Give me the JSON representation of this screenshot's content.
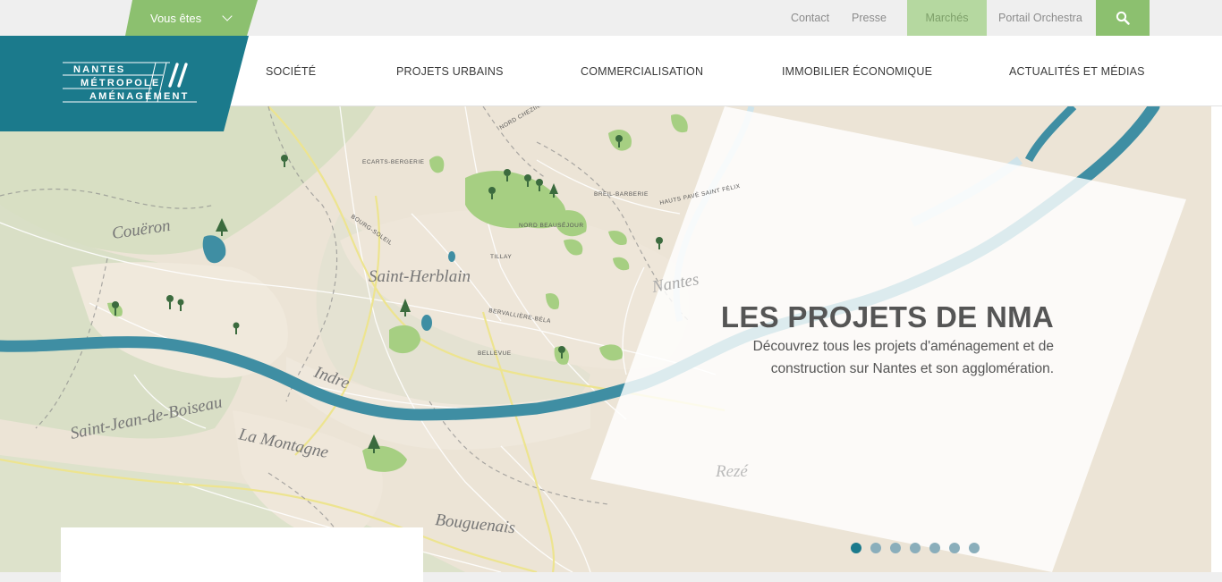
{
  "topbar": {
    "audience_label": "Vous êtes",
    "links": [
      "Contact",
      "Presse",
      "Marchés",
      "Portail Orchestra"
    ],
    "search_icon": "search-icon"
  },
  "logo": {
    "line1": "NANTES",
    "line2": "MÉTROPOLE",
    "line3": "AMÉNAGEMENT"
  },
  "nav": [
    "SOCIÉTÉ",
    "PROJETS URBAINS",
    "COMMERCIALISATION",
    "IMMOBILIER ÉCONOMIQUE",
    "ACTUALITÉS ET MÉDIAS"
  ],
  "hero": {
    "title": "LES PROJETS DE NMA",
    "description": "Découvrez tous les projets d'aménagement et de construction sur Nantes et son agglomération.",
    "slides": 7,
    "active_slide": 1,
    "map_labels": {
      "coueron": "Couëron",
      "saint_herblain": "Saint-Herblain",
      "indre": "Indre",
      "saint_jean": "Saint-Jean-de-Boiseau",
      "la_montagne": "La Montagne",
      "bouguenais": "Bouguenais",
      "nantes": "Nantes",
      "reze": "Rezé",
      "tillay": "TILLAY",
      "bellevue": "BELLEVUE",
      "breil": "BREIL-BARBERIE",
      "nord_beausejour": "NORD BEAUSÉJOUR",
      "bourg_soleil": "BOURG-SOLEIL",
      "ecarts": "ECARTS-BERGERIE",
      "hauts_pave": "HAUTS PAVÉ SAINT FÉLIX",
      "bernardiere": "BERVALLIÈRE-BÉLA",
      "nord_chezine": "NORD CHEZINE"
    }
  },
  "colors": {
    "teal": "#1b7a8c",
    "green": "#8cc06f",
    "river": "#3f8ea3",
    "park": "#a6cf82"
  }
}
